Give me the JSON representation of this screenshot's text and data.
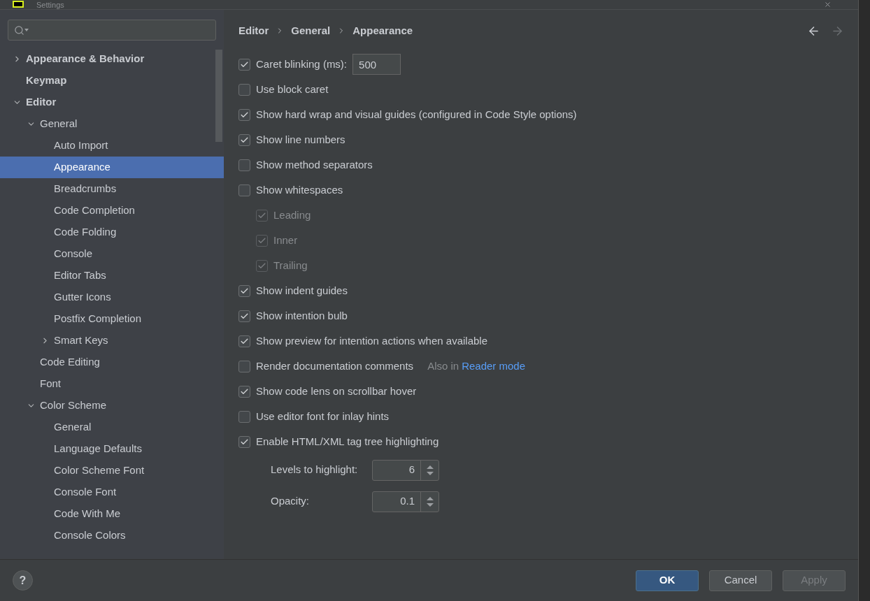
{
  "window": {
    "title": "Settings"
  },
  "sidebar": {
    "tree": [
      {
        "label": "Appearance & Behavior",
        "expanded": false,
        "selected": false
      },
      {
        "label": "Keymap",
        "selected": false
      },
      {
        "label": "Editor",
        "expanded": true,
        "selected": false,
        "children": [
          {
            "label": "General",
            "expanded": true,
            "selected": false,
            "children": [
              {
                "label": "Auto Import",
                "selected": false
              },
              {
                "label": "Appearance",
                "selected": true
              },
              {
                "label": "Breadcrumbs",
                "selected": false
              },
              {
                "label": "Code Completion",
                "selected": false
              },
              {
                "label": "Code Folding",
                "selected": false
              },
              {
                "label": "Console",
                "selected": false
              },
              {
                "label": "Editor Tabs",
                "selected": false
              },
              {
                "label": "Gutter Icons",
                "selected": false
              },
              {
                "label": "Postfix Completion",
                "selected": false
              },
              {
                "label": "Smart Keys",
                "expanded": false,
                "selected": false
              }
            ]
          },
          {
            "label": "Code Editing",
            "selected": false
          },
          {
            "label": "Font",
            "selected": false
          },
          {
            "label": "Color Scheme",
            "expanded": true,
            "selected": false,
            "children": [
              {
                "label": "General",
                "selected": false
              },
              {
                "label": "Language Defaults",
                "selected": false
              },
              {
                "label": "Color Scheme Font",
                "selected": false
              },
              {
                "label": "Console Font",
                "selected": false
              },
              {
                "label": "Code With Me",
                "selected": false
              },
              {
                "label": "Console Colors",
                "selected": false
              }
            ]
          }
        ]
      }
    ]
  },
  "breadcrumbs": [
    "Editor",
    "General",
    "Appearance"
  ],
  "options": [
    {
      "kind": "checkbox",
      "label": "Caret blinking (ms):",
      "checked": true,
      "disabled": false,
      "value": "500"
    },
    {
      "kind": "checkbox",
      "label": "Use block caret",
      "checked": false,
      "disabled": false
    },
    {
      "kind": "checkbox",
      "label": "Show hard wrap and visual guides (configured in Code Style options)",
      "checked": true,
      "disabled": false
    },
    {
      "kind": "checkbox",
      "label": "Show line numbers",
      "checked": true,
      "disabled": false
    },
    {
      "kind": "checkbox",
      "label": "Show method separators",
      "checked": false,
      "disabled": false
    },
    {
      "kind": "checkbox",
      "label": "Show whitespaces",
      "checked": false,
      "disabled": false,
      "children": [
        {
          "label": "Leading",
          "checked": true,
          "disabled": true
        },
        {
          "label": "Inner",
          "checked": true,
          "disabled": true
        },
        {
          "label": "Trailing",
          "checked": true,
          "disabled": true
        }
      ]
    },
    {
      "kind": "checkbox",
      "label": "Show indent guides",
      "checked": true,
      "disabled": false
    },
    {
      "kind": "checkbox",
      "label": "Show intention bulb",
      "checked": true,
      "disabled": false
    },
    {
      "kind": "checkbox",
      "label": "Show preview for intention actions when available",
      "checked": true,
      "disabled": false
    },
    {
      "kind": "checkbox",
      "label": "Render documentation comments",
      "checked": false,
      "disabled": false,
      "note": "Also in",
      "link": "Reader mode"
    },
    {
      "kind": "checkbox",
      "label": "Show code lens on scrollbar hover",
      "checked": true,
      "disabled": false
    },
    {
      "kind": "checkbox",
      "label": "Use editor font for inlay hints",
      "checked": false,
      "disabled": false
    },
    {
      "kind": "checkbox",
      "label": "Enable HTML/XML tag tree highlighting",
      "checked": true,
      "disabled": false
    },
    {
      "kind": "spinner",
      "label": "Levels to highlight:",
      "value": "6"
    },
    {
      "kind": "spinner",
      "label": "Opacity:",
      "value": "0.1"
    }
  ],
  "footer": {
    "help": "?",
    "buttons": [
      {
        "label": "OK",
        "primary": true,
        "disabled": false
      },
      {
        "label": "Cancel",
        "primary": false,
        "disabled": false
      },
      {
        "label": "Apply",
        "primary": false,
        "disabled": true
      }
    ]
  }
}
